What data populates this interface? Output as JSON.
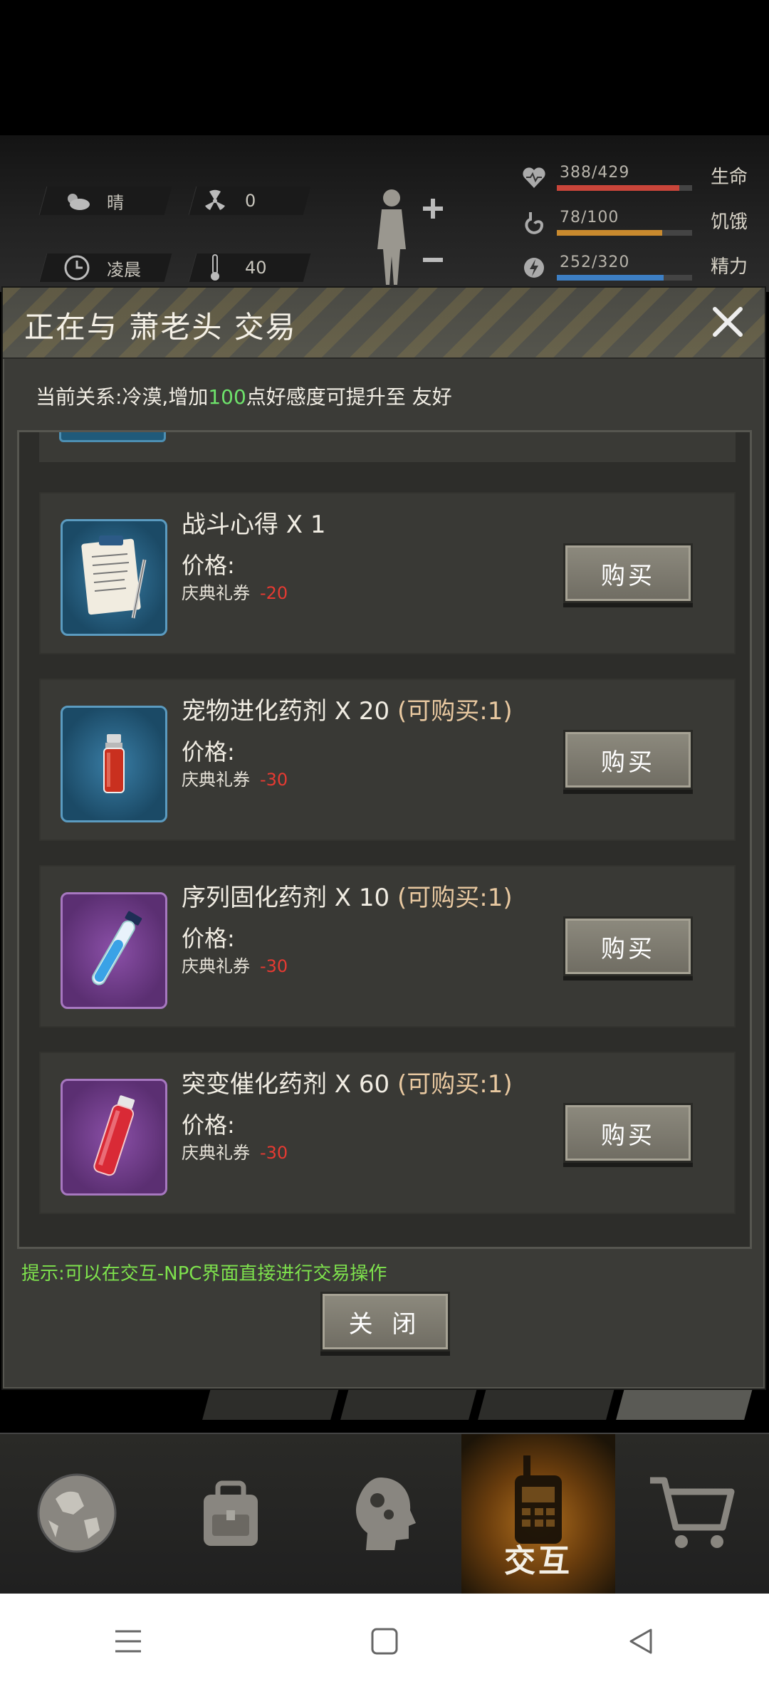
{
  "status": {
    "weather": "晴",
    "radiation": "0",
    "time_of_day": "凌晨",
    "temperature": "40",
    "health": {
      "value": "388/429",
      "label": "生命",
      "fraction": 0.904,
      "color": "#c9453a"
    },
    "hunger": {
      "value": "78/100",
      "label": "饥饿",
      "fraction": 0.78,
      "color": "#c98a2e"
    },
    "energy": {
      "value": "252/320",
      "label": "精力",
      "fraction": 0.788,
      "color": "#3d7fc4"
    }
  },
  "trade": {
    "title": "正在与 萧老头 交易",
    "relation_prefix": "当前关系:冷漠,增加",
    "relation_points": "100",
    "relation_suffix": "点好感度可提升至 友好",
    "items": [
      {
        "name": "战斗心得 X 1",
        "limit": "",
        "price_label": "价格:",
        "currency": "庆典礼券",
        "cost": "-20",
        "buy": "购买",
        "icon": "notes-clipboard-icon",
        "tint": "blue"
      },
      {
        "name": "宠物进化药剂 X 20",
        "limit": "(可购买:1)",
        "price_label": "价格:",
        "currency": "庆典礼券",
        "cost": "-30",
        "buy": "购买",
        "icon": "red-vial-icon",
        "tint": "blue"
      },
      {
        "name": "序列固化药剂 X 10",
        "limit": "(可购买:1)",
        "price_label": "价格:",
        "currency": "庆典礼券",
        "cost": "-30",
        "buy": "购买",
        "icon": "blue-test-tube-icon",
        "tint": "purple"
      },
      {
        "name": "突变催化药剂 X 60",
        "limit": "(可购买:1)",
        "price_label": "价格:",
        "currency": "庆典礼券",
        "cost": "-30",
        "buy": "购买",
        "icon": "red-flask-icon",
        "tint": "purple"
      }
    ],
    "hint": "提示:可以在交互-NPC界面直接进行交易操作",
    "close_label": "关 闭"
  },
  "bottom_nav": {
    "items": [
      {
        "name": "world",
        "label": ""
      },
      {
        "name": "backpack",
        "label": ""
      },
      {
        "name": "skills",
        "label": ""
      },
      {
        "name": "interact",
        "label": "交互"
      },
      {
        "name": "shop",
        "label": ""
      }
    ]
  }
}
